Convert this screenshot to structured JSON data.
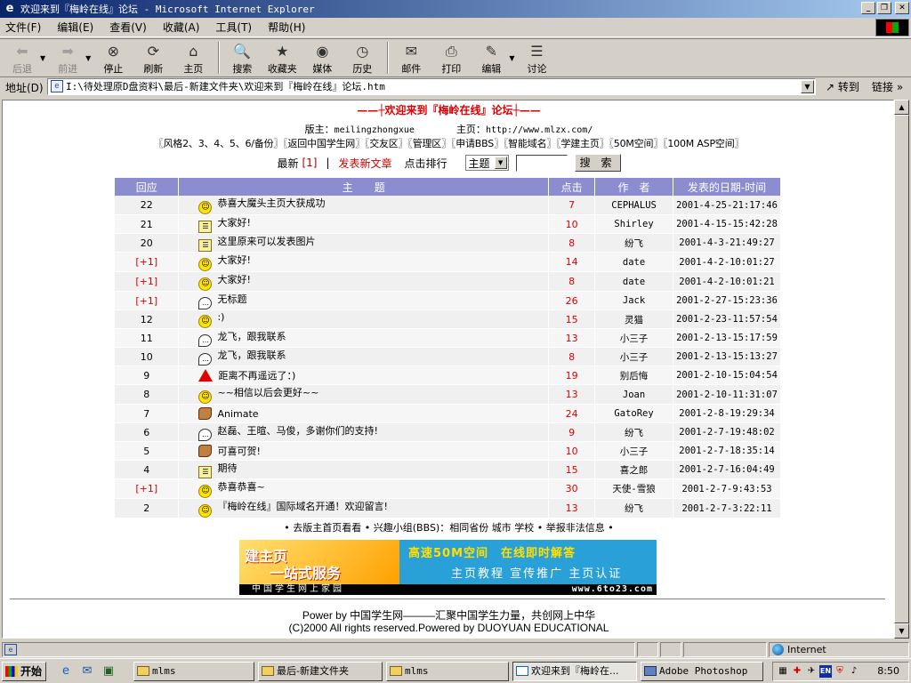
{
  "window": {
    "title": "欢迎来到『梅岭在线』论坛 - Microsoft Internet Explorer",
    "min_label": "_",
    "max_label": "❐",
    "close_label": "✕"
  },
  "menu": [
    "文件(F)",
    "编辑(E)",
    "查看(V)",
    "收藏(A)",
    "工具(T)",
    "帮助(H)"
  ],
  "toolbar": {
    "back": "后退",
    "forward": "前进",
    "stop": "停止",
    "refresh": "刷新",
    "home": "主页",
    "search": "搜索",
    "favorites": "收藏夹",
    "media": "媒体",
    "history": "历史",
    "mail": "邮件",
    "print": "打印",
    "edit": "编辑",
    "discuss": "讨论"
  },
  "address": {
    "label": "地址(D)",
    "value": "I:\\待处理原D盘资料\\最后-新建文件夹\\欢迎来到『梅岭在线』论坛.htm",
    "go": "转到",
    "links": "链接"
  },
  "page": {
    "banner": "——┼欢迎来到『梅岭在线』论坛┼——",
    "moderator_label": "版主：",
    "moderator": "meilingzhongxue",
    "homepage_label": "主页：",
    "homepage": "http://www.mlzx.com/",
    "nav": "〖风格2、3、4、5、6/备份〗〖返回中国学生网〗〖交友区〗〖管理区〗〖申请BBS〗〖智能域名〗〖学建主页〗〖50M空间〗〖100M ASP空间〗",
    "latest_label": "最新",
    "latest_count": "[1]",
    "separator": "|",
    "new_post": "发表新文章",
    "hits_rank": "点击排行",
    "select_value": "主题",
    "search_button": "搜 索",
    "columns": [
      "回应",
      "主　　题",
      "点击",
      "作　者",
      "发表的日期-时间"
    ],
    "rows": [
      {
        "reply": "22",
        "icon": "smile",
        "subject": "恭喜大魔头主页大获成功",
        "hits": "7",
        "author": "CEPHALUS",
        "date": "2001-4-25-21:17:46"
      },
      {
        "reply": "21",
        "icon": "note",
        "subject": "大家好!",
        "hits": "10",
        "author": "Shirley",
        "date": "2001-4-15-15:42:28"
      },
      {
        "reply": "20",
        "icon": "note",
        "subject": "这里原来可以发表图片",
        "hits": "8",
        "author": "纷飞",
        "date": "2001-4-3-21:49:27"
      },
      {
        "reply": "[+1]",
        "icon": "smile",
        "subject": "大家好!",
        "hits": "14",
        "author": "date",
        "date": "2001-4-2-10:01:27"
      },
      {
        "reply": "[+1]",
        "icon": "smile",
        "subject": "大家好!",
        "hits": "8",
        "author": "date",
        "date": "2001-4-2-10:01:21"
      },
      {
        "reply": "[+1]",
        "icon": "bubble",
        "subject": "无标题",
        "hits": "26",
        "author": "Jack",
        "date": "2001-2-27-15:23:36"
      },
      {
        "reply": "12",
        "icon": "smile",
        "subject": ":)",
        "hits": "15",
        "author": "灵猫",
        "date": "2001-2-23-11:57:54"
      },
      {
        "reply": "11",
        "icon": "bubble",
        "subject": "龙飞，跟我联系",
        "hits": "13",
        "author": "小三子",
        "date": "2001-2-13-15:17:59"
      },
      {
        "reply": "10",
        "icon": "bubble",
        "subject": "龙飞，跟我联系",
        "hits": "8",
        "author": "小三子",
        "date": "2001-2-13-15:13:27"
      },
      {
        "reply": "9",
        "icon": "warn",
        "subject": "距离不再遥远了：)",
        "hits": "19",
        "author": "别后悔",
        "date": "2001-2-10-15:04:54"
      },
      {
        "reply": "8",
        "icon": "smile",
        "subject": "~~相信以后会更好~~",
        "hits": "13",
        "author": "Joan",
        "date": "2001-2-10-11:31:07"
      },
      {
        "reply": "7",
        "icon": "thumb",
        "subject": "Animate",
        "hits": "24",
        "author": "GatoRey",
        "date": "2001-2-8-19:29:34"
      },
      {
        "reply": "6",
        "icon": "bubble",
        "subject": "赵磊、王暄、马俊，多谢你们的支持!",
        "hits": "9",
        "author": "纷飞",
        "date": "2001-2-7-19:48:02"
      },
      {
        "reply": "5",
        "icon": "thumb",
        "subject": "可喜可贺!",
        "hits": "10",
        "author": "小三子",
        "date": "2001-2-7-18:35:14"
      },
      {
        "reply": "4",
        "icon": "note",
        "subject": "期待",
        "hits": "15",
        "author": "喜之郎",
        "date": "2001-2-7-16:04:49"
      },
      {
        "reply": "[+1]",
        "icon": "smile",
        "subject": "恭喜恭喜~",
        "hits": "30",
        "author": "天使-雪狼",
        "date": "2001-2-7-9:43:53"
      },
      {
        "reply": "2",
        "icon": "smile",
        "subject": "『梅岭在线』国际域名开通！欢迎留言!",
        "hits": "13",
        "author": "纷飞",
        "date": "2001-2-7-3:22:11"
      }
    ],
    "footer_links": "• 去版主首页看看 • 兴趣小组(BBS)：相同省份 城市 学校 • 举报非法信息 •",
    "ad": {
      "left_line1": "建主页",
      "left_line2": "一站式服务",
      "right_line1": "高速50M空间　在线即时解答",
      "right_line2": "主页教程 宣传推广 主页认证",
      "strip_left": "中国学生网上家园",
      "strip_right": "www.6to23.com"
    },
    "powered": "Power by 中国学生网———汇聚中国学生力量，共创网上中华",
    "copyright": "(C)2000 All rights reserved.Powered by DUOYUAN EDUCATIONAL"
  },
  "status": {
    "zone": "Internet"
  },
  "taskbar": {
    "start": "开始",
    "tasks": [
      "mlms",
      "最后-新建文件夹",
      "mlms",
      "欢迎来到『梅岭在...",
      "Adobe Photoshop"
    ],
    "clock": "8:50"
  }
}
